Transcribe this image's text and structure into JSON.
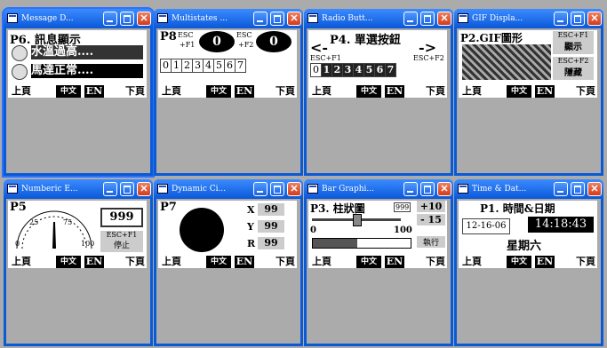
{
  "nav": {
    "prev": "上頁",
    "zh": "中文",
    "en": "EN",
    "next": "下頁"
  },
  "windows": [
    {
      "title": "Message D...",
      "page": "P6. 訊息顯示",
      "msg1": "水溫過高....",
      "msg2": "馬達正常...."
    },
    {
      "title": "Multistates ...",
      "page": "P8",
      "esc1": "ESC",
      "f1": "+F1",
      "esc2": "ESC",
      "f2": "+F2",
      "state1": "0",
      "state2": "0",
      "digits": [
        "0",
        "1",
        "2",
        "3",
        "4",
        "5",
        "6",
        "7"
      ]
    },
    {
      "title": "Radio Butt...",
      "page": "P4. 單選按鈕",
      "left_arrow": "<-",
      "right_arrow": "->",
      "escf1": "ESC+F1",
      "escf2": "ESC+F2",
      "digits": [
        "0",
        "1",
        "2",
        "3",
        "4",
        "5",
        "6",
        "7"
      ]
    },
    {
      "title": "GIF Displa...",
      "page": "P2.GIF圖形",
      "b1a": "ESC+F1",
      "b1b": "顯示",
      "b2a": "ESC+F2",
      "b2b": "隱藏"
    },
    {
      "title": "Numberic E...",
      "page": "P5",
      "g25": "25",
      "g75": "75",
      "g0": "0",
      "g100": "100",
      "value": "999",
      "btn_a": "ESC+F1",
      "btn_b": "停止"
    },
    {
      "title": "Dynamic Ci...",
      "page": "P7",
      "xl": "X",
      "xv": "99",
      "yl": "Y",
      "yv": "99",
      "rl": "R",
      "rv": "99"
    },
    {
      "title": "Bar Graphi...",
      "page": "P3. 柱狀圖",
      "val": "999",
      "plus": "+10",
      "minus": "- 15",
      "zero": "0",
      "hundred": "100",
      "exec": "執行"
    },
    {
      "title": "Time & Dat...",
      "page": "P1. 時間&日期",
      "date": "12-16-06",
      "time": "14:18:43",
      "weekday": "星期六"
    }
  ],
  "colors": {
    "titlebar": "#0a58d8",
    "close": "#d23c1c",
    "client": "#ababab"
  },
  "icons": [
    "app-icon",
    "minimize-icon",
    "maximize-icon",
    "close-icon"
  ]
}
